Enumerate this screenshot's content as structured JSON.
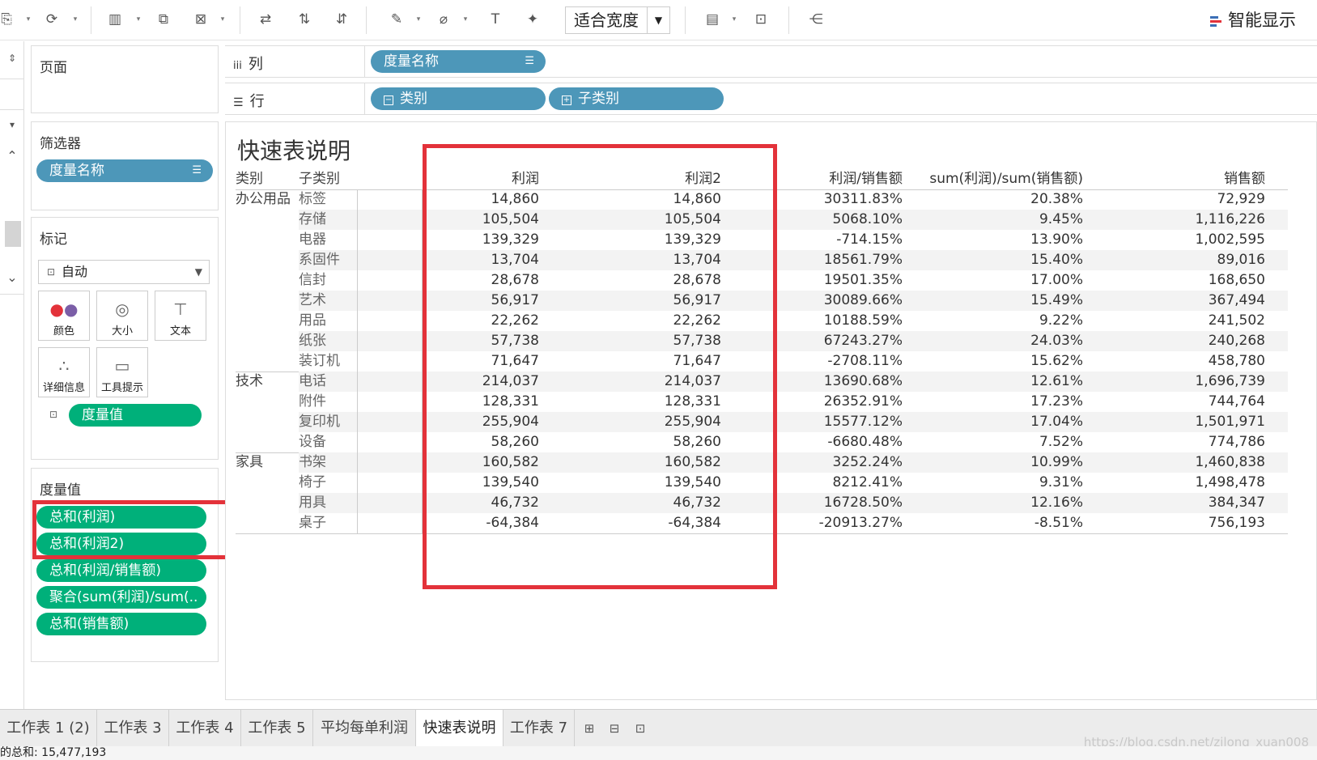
{
  "toolbar": {
    "fit_label": "适合宽度",
    "show_me_label": "智能显示",
    "accent_colors": [
      "#e3323a",
      "#4d97b9",
      "#00b07a"
    ]
  },
  "pages_card": {
    "title": "页面"
  },
  "filters_card": {
    "title": "筛选器",
    "pill": "度量名称"
  },
  "marks_card": {
    "title": "标记",
    "type_label": "自动",
    "buttons": [
      "颜色",
      "大小",
      "文本",
      "详细信息",
      "工具提示"
    ],
    "text_pill": "度量值"
  },
  "measure_values_card": {
    "title": "度量值",
    "pills": [
      "总和(利润)",
      "总和(利润2)",
      "总和(利润/销售额)",
      "聚合(sum(利润)/sum(..",
      "总和(销售额)"
    ]
  },
  "shelves": {
    "columns_label": "列",
    "columns_pill": "度量名称",
    "rows_label": "行",
    "rows_pills": [
      "类别",
      "子类别"
    ]
  },
  "view": {
    "title": "快速表说明",
    "headers": [
      "类别",
      "子类别",
      "利润",
      "利润2",
      "利润/销售额",
      "sum(利润)/sum(销售额)",
      "销售额"
    ],
    "groups": [
      {
        "category": "办公用品",
        "rows": [
          [
            "标签",
            "14,860",
            "14,860",
            "30311.83%",
            "20.38%",
            "72,929"
          ],
          [
            "存储",
            "105,504",
            "105,504",
            "5068.10%",
            "9.45%",
            "1,116,226"
          ],
          [
            "电器",
            "139,329",
            "139,329",
            "-714.15%",
            "13.90%",
            "1,002,595"
          ],
          [
            "系固件",
            "13,704",
            "13,704",
            "18561.79%",
            "15.40%",
            "89,016"
          ],
          [
            "信封",
            "28,678",
            "28,678",
            "19501.35%",
            "17.00%",
            "168,650"
          ],
          [
            "艺术",
            "56,917",
            "56,917",
            "30089.66%",
            "15.49%",
            "367,494"
          ],
          [
            "用品",
            "22,262",
            "22,262",
            "10188.59%",
            "9.22%",
            "241,502"
          ],
          [
            "纸张",
            "57,738",
            "57,738",
            "67243.27%",
            "24.03%",
            "240,268"
          ],
          [
            "装订机",
            "71,647",
            "71,647",
            "-2708.11%",
            "15.62%",
            "458,780"
          ]
        ]
      },
      {
        "category": "技术",
        "rows": [
          [
            "电话",
            "214,037",
            "214,037",
            "13690.68%",
            "12.61%",
            "1,696,739"
          ],
          [
            "附件",
            "128,331",
            "128,331",
            "26352.91%",
            "17.23%",
            "744,764"
          ],
          [
            "复印机",
            "255,904",
            "255,904",
            "15577.12%",
            "17.04%",
            "1,501,971"
          ],
          [
            "设备",
            "58,260",
            "58,260",
            "-6680.48%",
            "7.52%",
            "774,786"
          ]
        ]
      },
      {
        "category": "家具",
        "rows": [
          [
            "书架",
            "160,582",
            "160,582",
            "3252.24%",
            "10.99%",
            "1,460,838"
          ],
          [
            "椅子",
            "139,540",
            "139,540",
            "8212.41%",
            "9.31%",
            "1,498,478"
          ],
          [
            "用具",
            "46,732",
            "46,732",
            "16728.50%",
            "12.16%",
            "384,347"
          ],
          [
            "桌子",
            "-64,384",
            "-64,384",
            "-20913.27%",
            "-8.51%",
            "756,193"
          ]
        ]
      }
    ]
  },
  "tabs": [
    "工作表 1 (2)",
    "工作表 3",
    "工作表 4",
    "工作表 5",
    "平均每单利润",
    "快速表说明",
    "工作表 7"
  ],
  "active_tab": "快速表说明",
  "status": "的总和: 15,477,193",
  "watermark": "https://blog.csdn.net/zilong_xuan008"
}
